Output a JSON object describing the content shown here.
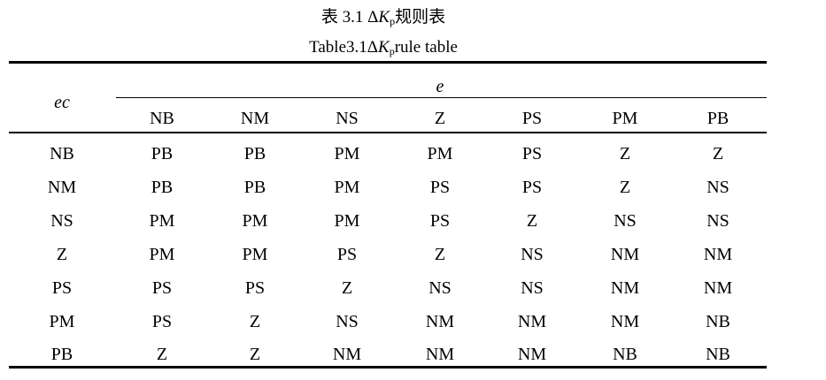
{
  "caption": {
    "cn_prefix": "表 3.1 Δ",
    "cn_k": "K",
    "cn_sub": "p",
    "cn_suffix": "规则表",
    "en_prefix": "Table3.1Δ",
    "en_k": "K",
    "en_sub": "p",
    "en_suffix": "rule table"
  },
  "table": {
    "row_header_label": "ec",
    "col_group_label": "e",
    "columns": [
      "NB",
      "NM",
      "NS",
      "Z",
      "PS",
      "PM",
      "PB"
    ],
    "rows": [
      {
        "label": "NB",
        "cells": [
          "PB",
          "PB",
          "PM",
          "PM",
          "PS",
          "Z",
          "Z"
        ]
      },
      {
        "label": "NM",
        "cells": [
          "PB",
          "PB",
          "PM",
          "PS",
          "PS",
          "Z",
          "NS"
        ]
      },
      {
        "label": "NS",
        "cells": [
          "PM",
          "PM",
          "PM",
          "PS",
          "Z",
          "NS",
          "NS"
        ]
      },
      {
        "label": "Z",
        "cells": [
          "PM",
          "PM",
          "PS",
          "Z",
          "NS",
          "NM",
          "NM"
        ]
      },
      {
        "label": "PS",
        "cells": [
          "PS",
          "PS",
          "Z",
          "NS",
          "NS",
          "NM",
          "NM"
        ]
      },
      {
        "label": "PM",
        "cells": [
          "PS",
          "Z",
          "NS",
          "NM",
          "NM",
          "NM",
          "NB"
        ]
      },
      {
        "label": "PB",
        "cells": [
          "Z",
          "Z",
          "NM",
          "NM",
          "NM",
          "NB",
          "NB"
        ]
      }
    ]
  }
}
